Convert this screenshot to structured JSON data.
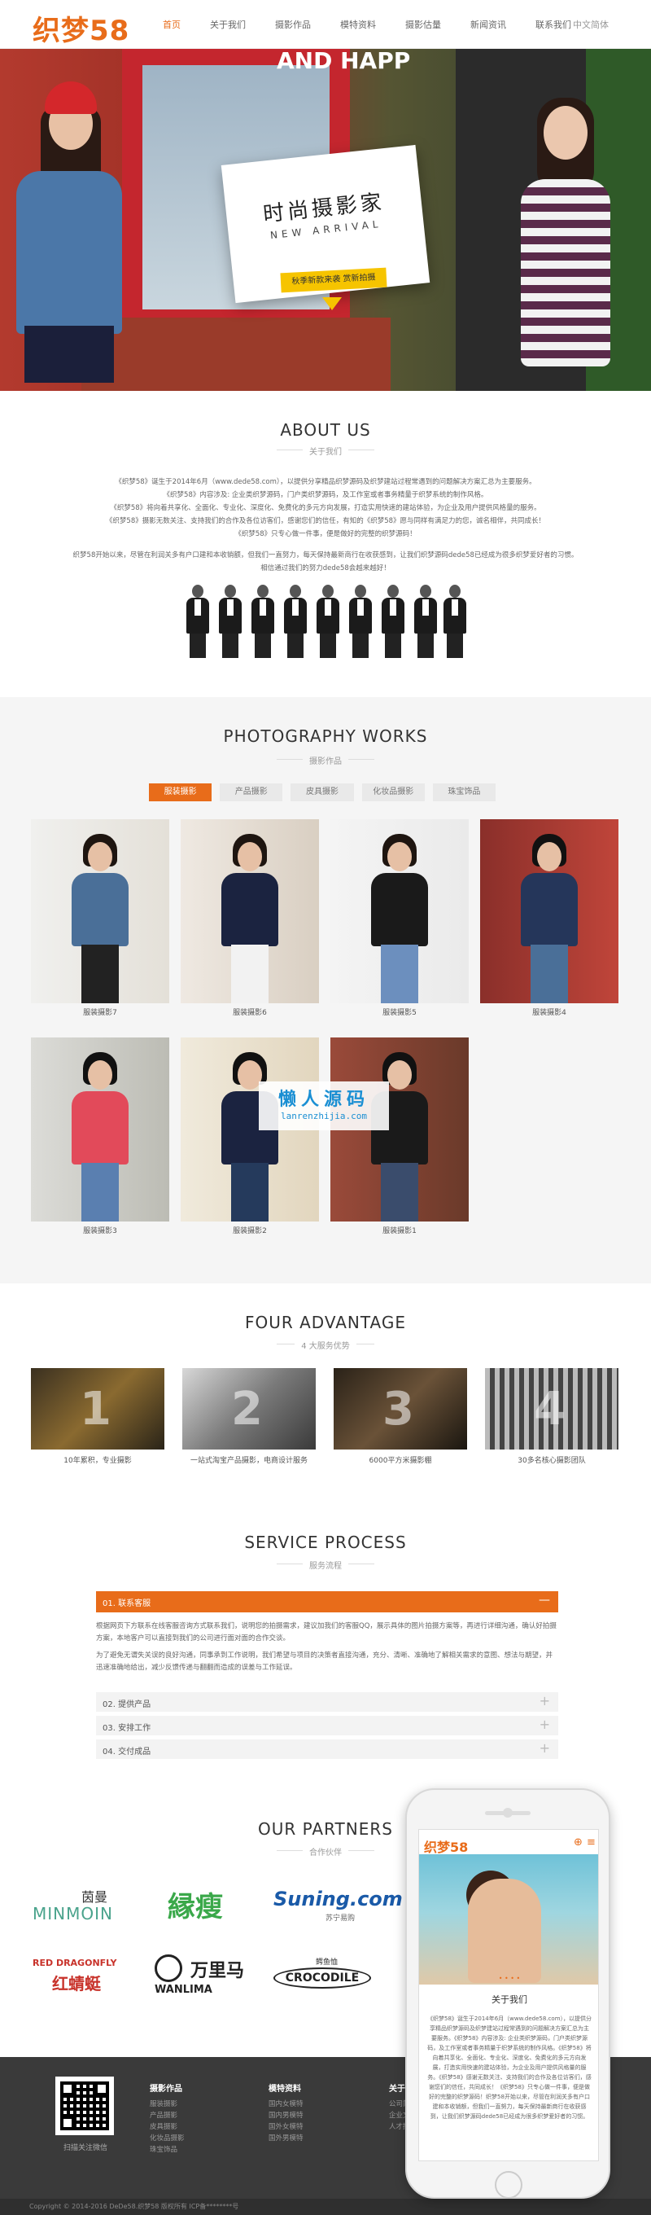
{
  "header": {
    "logo": "织梦58",
    "nav": [
      "首页",
      "关于我们",
      "摄影作品",
      "模特资料",
      "摄影估量",
      "新闻资讯",
      "联系我们"
    ],
    "lang": "中文简体"
  },
  "banner": {
    "title": "时尚摄影家",
    "subtitle": "NEW ARRIVAL",
    "tag": "秋季新款来袭 赏新拍摄",
    "sign": "AND HAPP"
  },
  "about": {
    "title": "ABOUT US",
    "subtitle": "关于我们",
    "p1": "《织梦58》诞生于2014年6月（www.dede58.com），以提供分享精品织梦源码及织梦建站过程常遇到的问题解决方案汇总为主要服务。",
    "p2": "《织梦58》内容涉及: 企业类织梦源码，门户类织梦源码，及工作室或者事务精量于织梦系统的制作风格。",
    "p3": "《织梦58》将向着共享化、全面化、专业化、深度化、免费化的多元方向发展，打造实用快速的建站体验，为企业及用户提供风格量的服务。",
    "p4": "《织梦58》摄影无数关注、支持我们的合作及各位访客们，感谢您们的信任，有知的《织梦58》愿与同样有满足力的您，诚名相伴，共同成长！",
    "p5": "《织梦58》只专心做一件事，便是做好的完整的织梦源码！",
    "p6": "织梦58开始以来，尽管在利润关多有户口建和本收销额，但我们一直努力，每天保持最新商行在收获感到，让我们织梦源码dede58已经成为很多织梦爱好者的习惯。",
    "p7": "相信通过我们的努力dede58会越来越好！"
  },
  "works": {
    "title": "PHOTOGRAPHY WORKS",
    "subtitle": "摄影作品",
    "tabs": [
      "服装摄影",
      "产品摄影",
      "皮具摄影",
      "化妆品摄影",
      "珠宝饰品"
    ],
    "items": [
      "服装摄影7",
      "服装摄影6",
      "服装摄影5",
      "服装摄影4",
      "服装摄影3",
      "服装摄影2",
      "服装摄影1"
    ]
  },
  "watermark": {
    "cn": "懒人源码",
    "en": "lanrenzhijia.com"
  },
  "advantage": {
    "title": "FOUR ADVANTAGE",
    "subtitle": "4 大服务优势",
    "items": [
      {
        "num": "1",
        "label": "10年累积，专业摄影"
      },
      {
        "num": "2",
        "label": "一站式淘宝产品摄影，电商设计服务"
      },
      {
        "num": "3",
        "label": "6000平方米摄影棚"
      },
      {
        "num": "4",
        "label": "30多名核心摄影团队"
      }
    ]
  },
  "service": {
    "title": "SERVICE PROCESS",
    "subtitle": "服务流程",
    "open_item": "01. 联系客服",
    "open_icon": "—",
    "body1": "根据网页下方联系在线客服咨询方式联系我们，说明您的拍摄需求，建议加我们的客服QQ，展示具体的图片拍摄方案等，再进行详细沟通，确认好拍摄方案，本地客户可以直接到我们的公司进行面对面的合作交谈。",
    "body2": "为了避免无谓失关误的良好沟通，同事承到工作说明，我们希望与项目的决策者直接沟通，充分、清晰、准确地了解相关需求的意图、想法与期望，并迅速准确地给出，减少反馈传递与翻翻而造成的误差与工作延误。",
    "items": [
      "02. 提供产品",
      "03. 安排工作",
      "04. 交付成品"
    ],
    "plus": "+"
  },
  "partners": {
    "title": "OUR PARTNERS",
    "subtitle": "合作伙伴",
    "logos": [
      "茵曼",
      "MINMOIN",
      "縁瘦",
      "Suning.com",
      "苏宁易购",
      "RED DRAGONFLY",
      "红蜻蜓",
      "万里马",
      "WANLIMA",
      "鳄鱼恤",
      "CROCODILE"
    ]
  },
  "footer": {
    "qr_caption": "扫描关注微信",
    "cols": [
      {
        "head": "摄影作品",
        "items": [
          "服装摄影",
          "产品摄影",
          "皮具摄影",
          "化妆品摄影",
          "珠宝饰品"
        ]
      },
      {
        "head": "模特资料",
        "items": [
          "国内女模特",
          "国内男模特",
          "国外女模特",
          "国外男模特"
        ]
      },
      {
        "head": "关于我们",
        "items": [
          "公司简介",
          "企业文化",
          "人才招聘"
        ]
      }
    ],
    "copyright": "Copyright © 2014-2016 DeDe58.织梦58 版权所有    ICP备********号"
  },
  "phone": {
    "logo": "织梦58",
    "globe": "⊕",
    "menu": "≡",
    "dots": "• • • •",
    "title": "关于我们",
    "text": "《织梦58》诞生于2014年6月（www.dede58.com），以提供分享精品织梦源码及织梦建站过程常遇到的问题解决方案汇总为主要服务。《织梦58》内容涉及: 企业类织梦源码，门户类织梦源码，及工作室或者事务精量于织梦系统的制作风格。《织梦58》将向着共享化、全面化、专业化、深度化、免费化的多元方向发展，打造实用快速的建站体验，为企业及用户提供风格量的服务。《织梦58》感谢无数关注、支持我们的合作及各位访客们，感谢您们的信任，共同成长！《织梦58》只专心做一件事，便是做好的完整的织梦源码！织梦58开始以来，尽管在利润关多有户口建和本收销额，但我们一直努力，每天保持最新商行在收获感到，让我们织梦源码dede58已经成为很多织梦爱好者的习惯。"
  },
  "colors": {
    "accent": "#e86c1a",
    "footer": "#3a3a3a"
  }
}
